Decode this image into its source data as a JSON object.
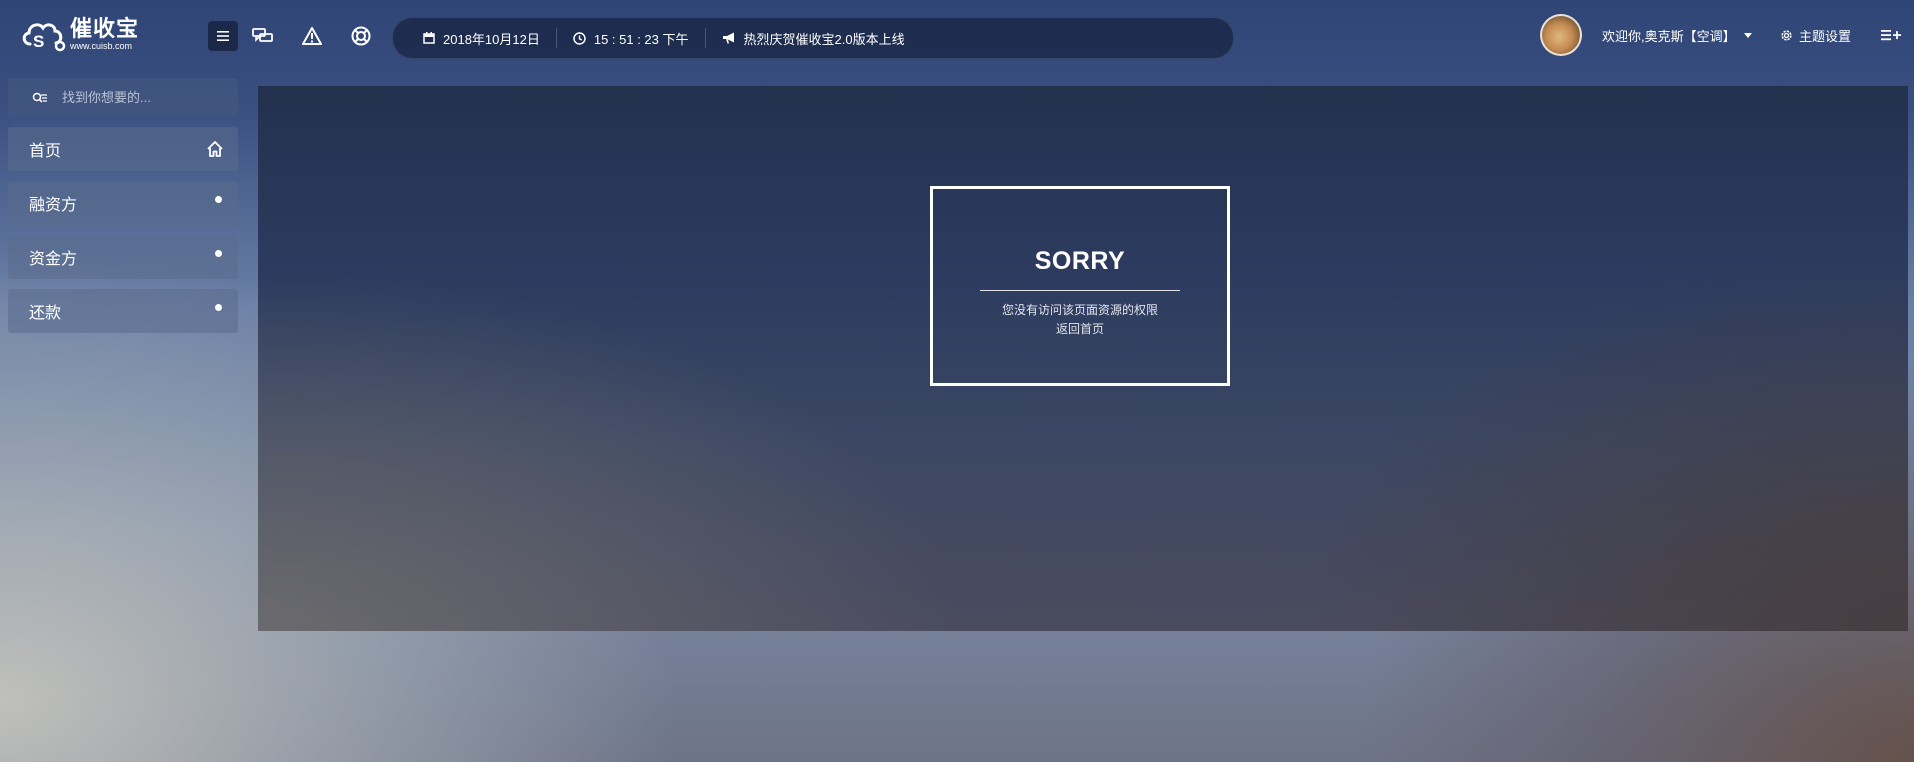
{
  "brand": {
    "name": "催收宝",
    "url": "www.cuisb.com"
  },
  "header": {
    "menu_icon": "hamburger-icon",
    "tool_icons": [
      "chat-icon",
      "warning-icon",
      "lifebuoy-icon"
    ],
    "date": "2018年10月12日",
    "time": "15 : 51 : 23 下午",
    "announcement": "热烈庆贺催收宝2.0版本上线",
    "welcome": "欢迎你,奥克斯【空调】",
    "theme_label": "主题设置"
  },
  "sidebar": {
    "search_placeholder": "找到你想要的...",
    "items": [
      {
        "label": "首页",
        "icon": "home-icon"
      },
      {
        "label": "融资方",
        "icon": "dot"
      },
      {
        "label": "资金方",
        "icon": "dot"
      },
      {
        "label": "还款",
        "icon": "dot"
      }
    ]
  },
  "error": {
    "title": "SORRY",
    "message": "您没有访问该页面资源的权限",
    "link": "返回首页"
  }
}
